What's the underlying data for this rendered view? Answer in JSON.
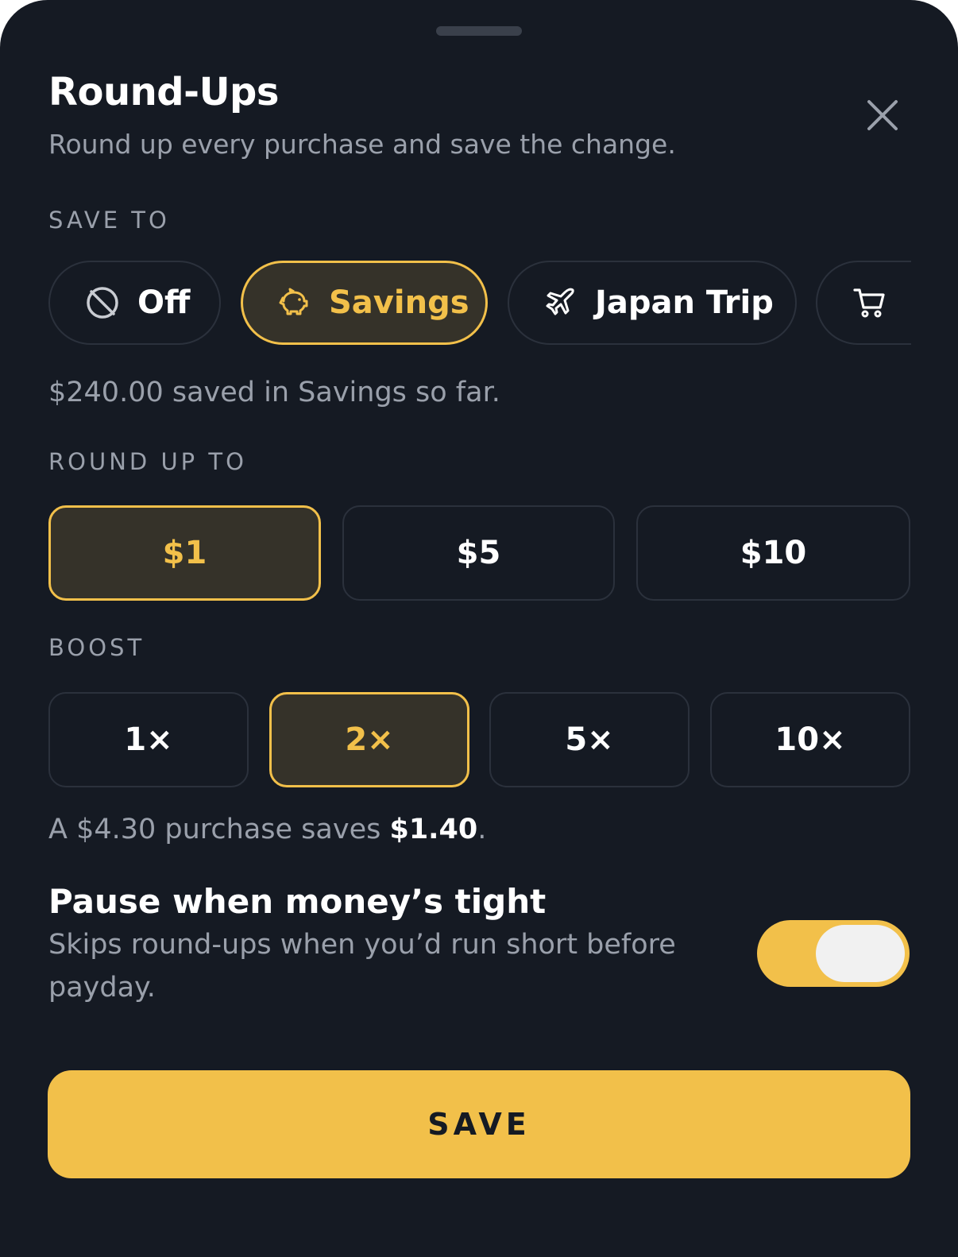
{
  "sheet": {
    "title": "Round-Ups",
    "subtitle": "Round up every purchase and save the change.",
    "close_icon": "close-icon"
  },
  "save_to": {
    "label": "SAVE TO",
    "options": [
      {
        "label": "Off",
        "icon": "off-circle-slash-icon",
        "selected": false
      },
      {
        "label": "Savings",
        "icon": "piggy-bank-icon",
        "selected": true
      },
      {
        "label": "Japan Trip",
        "icon": "airplane-icon",
        "selected": false
      },
      {
        "label": "",
        "icon": "shopping-cart-icon",
        "selected": false
      }
    ],
    "helper": "$240.00 saved in Savings so far."
  },
  "round_up": {
    "label": "ROUND UP TO",
    "options": [
      "$1",
      "$5",
      "$10"
    ],
    "selected": "$1"
  },
  "boost": {
    "label": "BOOST",
    "options": [
      "1×",
      "2×",
      "5×",
      "10×"
    ],
    "selected": "2×",
    "example_prefix": "A $4.30 purchase saves ",
    "example_amount": "$1.40",
    "example_suffix": "."
  },
  "pause": {
    "title": "Pause when money’s tight",
    "description": "Skips round-ups when you’d run short before payday.",
    "enabled": true
  },
  "save_button": {
    "label": "SAVE"
  },
  "colors": {
    "background": "#151a23",
    "accent": "#f2c04a",
    "selected_fill": "#353229",
    "muted_text": "#9aa0ab",
    "border": "#2b313c"
  }
}
